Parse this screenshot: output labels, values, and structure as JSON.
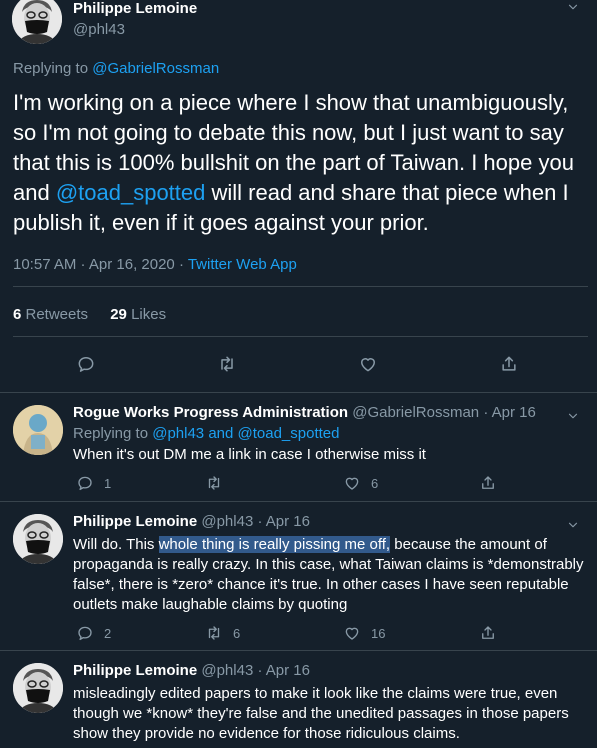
{
  "main_tweet": {
    "author_name": "Philippe Lemoine",
    "author_handle": "@phl43",
    "replying_prefix": "Replying to ",
    "replying_to": "@GabrielRossman",
    "body_part1": "I'm working on a piece where I show that unambiguously, so I'm not going to debate this now, but I just want to say that this is 100% bullshit on the part of Taiwan. I hope you and ",
    "body_mention": "@toad_spotted",
    "body_part2": " will read and share that piece when I publish it, even if it goes against your prior.",
    "timestamp": "10:57 AM · Apr 16, 2020 · ",
    "source": "Twitter Web App",
    "retweets_count": "6",
    "retweets_label": " Retweets",
    "likes_count": "29",
    "likes_label": " Likes"
  },
  "replies": [
    {
      "author_name": "Rogue Works Progress Administration",
      "author_meta": " @GabrielRossman · Apr 16",
      "replying_prefix": "Replying to ",
      "replying_to": "@phl43 and @toad_spotted",
      "text": "When it's out DM me a link in case I otherwise miss it",
      "reply_count": "1",
      "retweet_count": "",
      "like_count": "6"
    },
    {
      "author_name": "Philippe Lemoine",
      "author_meta": " @phl43 · Apr 16",
      "text_before": "Will do. This ",
      "text_highlight": "whole thing is really pissing me off,",
      "text_after": " because the amount of propaganda is really crazy. In this case, what Taiwan claims is *demonstrably false*, there is *zero* chance it's true. In other cases I have seen reputable outlets make laughable claims by quoting",
      "reply_count": "2",
      "retweet_count": "6",
      "like_count": "16"
    },
    {
      "author_name": "Philippe Lemoine",
      "author_meta": " @phl43 · Apr 16",
      "text": "misleadingly edited papers to make it look like the claims were true, even though we *know* they're false and the unedited passages in those papers show they provide no evidence for those ridiculous claims."
    }
  ],
  "icons": [
    "reply-icon",
    "retweet-icon",
    "like-icon",
    "share-icon",
    "chevron-down-icon"
  ],
  "colors": {
    "background": "#15202b",
    "link": "#1da1f2",
    "muted": "#8899a6",
    "divider": "#38444d",
    "highlight": "#325a8c"
  }
}
